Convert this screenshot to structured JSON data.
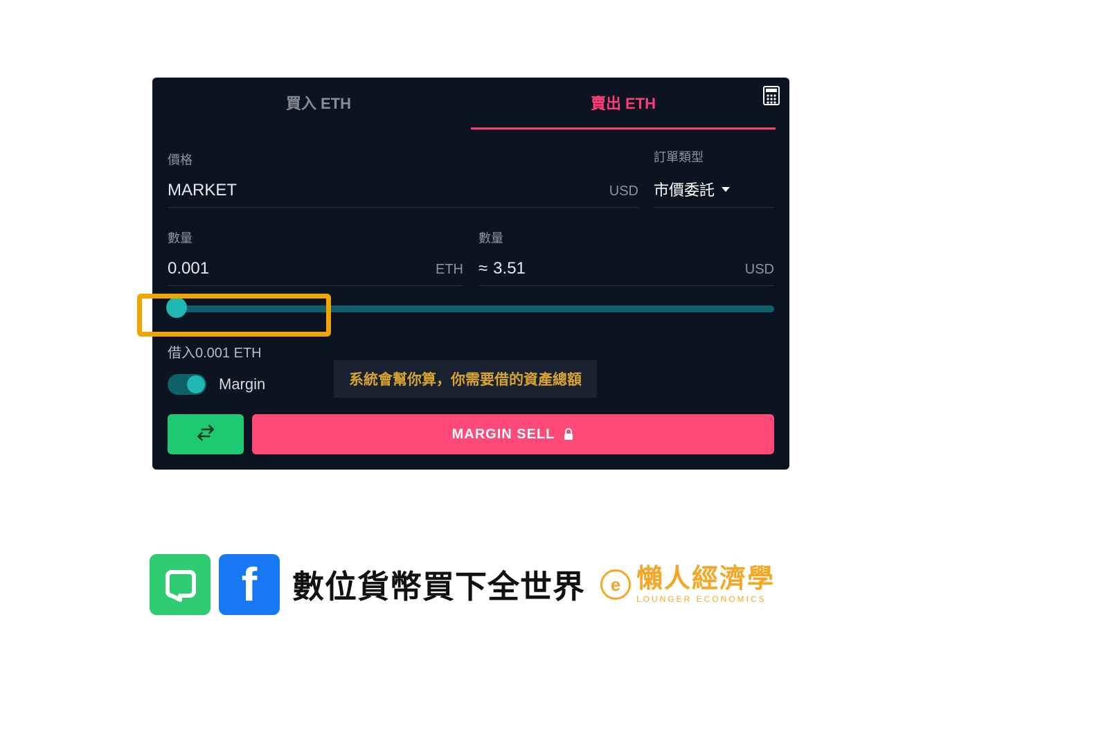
{
  "tabs": {
    "buy": "買入 ETH",
    "sell": "賣出 ETH"
  },
  "labels": {
    "price": "價格",
    "order_type": "訂單類型",
    "qty_crypto": "數量",
    "qty_fiat": "數量"
  },
  "price": {
    "value": "MARKET",
    "unit": "USD"
  },
  "order_type": {
    "selected": "市價委託"
  },
  "qty": {
    "crypto_value": "0.001",
    "crypto_unit": "ETH",
    "approx": "≈",
    "fiat_value": "3.51",
    "fiat_unit": "USD"
  },
  "borrow_text": "借入0.001 ETH",
  "margin_label": "Margin",
  "annotation": "系統會幫你算，你需要借的資產總額",
  "actions": {
    "sell_label": "MARGIN SELL"
  },
  "footer": {
    "title": "數位貨幣買下全世界",
    "lounger_cn": "懶人經濟學",
    "lounger_en": "LOUNGER ECONOMICS"
  }
}
